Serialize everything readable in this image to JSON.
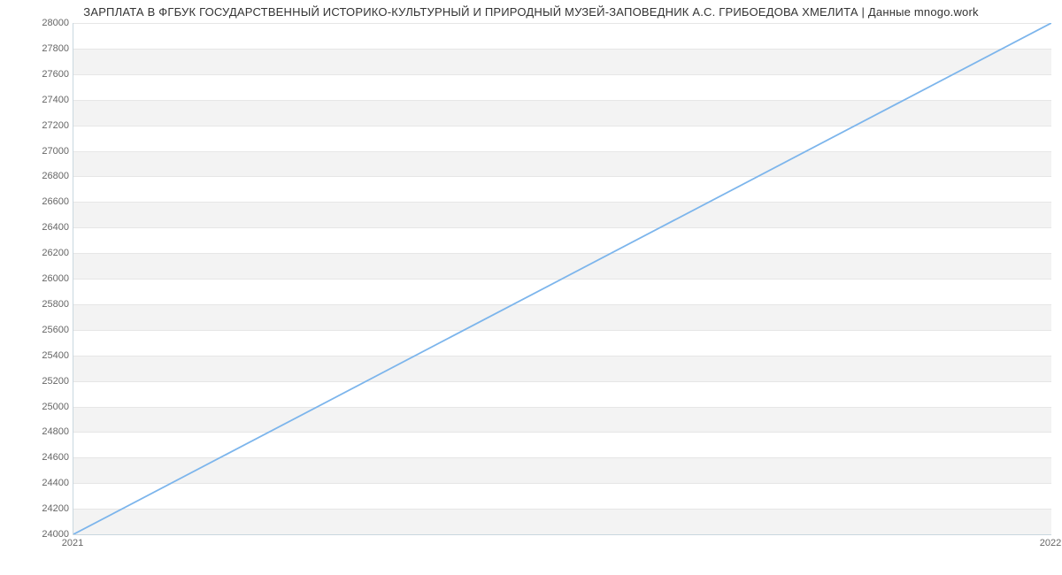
{
  "chart_data": {
    "type": "line",
    "title": "ЗАРПЛАТА В ФГБУК ГОСУДАРСТВЕННЫЙ ИСТОРИКО-КУЛЬТУРНЫЙ  И ПРИРОДНЫЙ МУЗЕЙ-ЗАПОВЕДНИК А.С. ГРИБОЕДОВА ХМЕЛИТА | Данные mnogo.work",
    "x": [
      2021,
      2022
    ],
    "y": [
      24000,
      28000
    ],
    "xlabel": "",
    "ylabel": "",
    "ylim": [
      24000,
      28000
    ],
    "xlim": [
      2021,
      2022
    ],
    "y_ticks": [
      24000,
      24200,
      24400,
      24600,
      24800,
      25000,
      25200,
      25400,
      25600,
      25800,
      26000,
      26200,
      26400,
      26600,
      26800,
      27000,
      27200,
      27400,
      27600,
      27800,
      28000
    ],
    "x_ticks": [
      2021,
      2022
    ],
    "series_color": "#7cb5ec",
    "band_color": "#f3f3f3"
  }
}
